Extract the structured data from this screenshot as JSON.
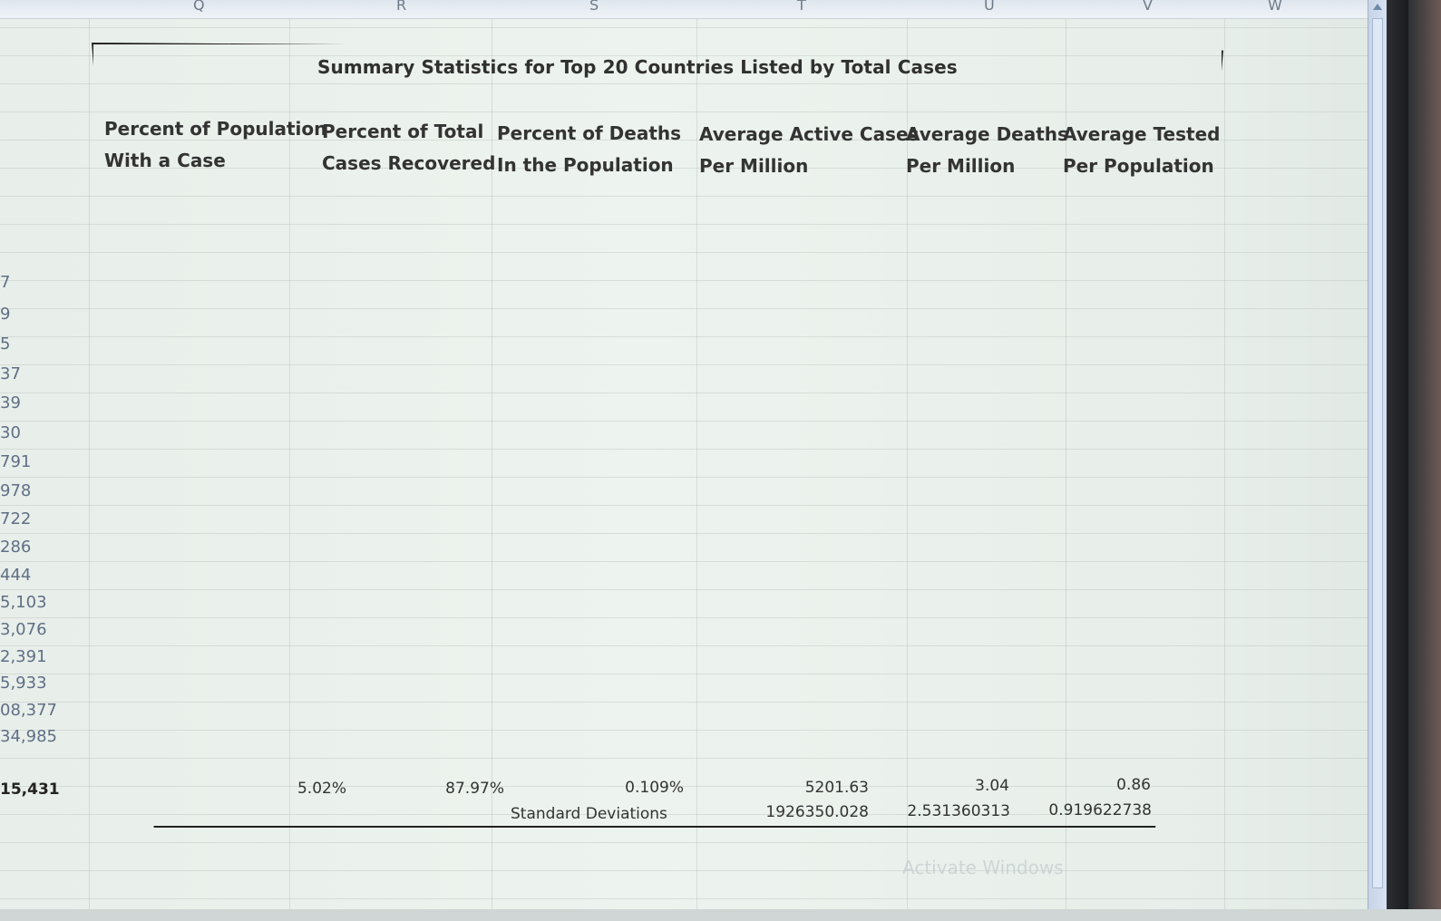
{
  "columns": [
    "Q",
    "R",
    "S",
    "T",
    "U",
    "V",
    "W"
  ],
  "left_column_values": [
    "7",
    "9",
    "5",
    "37",
    "39",
    "30",
    "791",
    "978",
    "722",
    "286",
    "444",
    "5,103",
    "3,076",
    "2,391",
    "5,933",
    "08,377",
    "34,985"
  ],
  "left_total": "15,431",
  "summary": {
    "title": "Summary Statistics for Top 20 Countries Listed by Total Cases",
    "headers": [
      {
        "line1": "Percent of Population",
        "line2": "With a Case"
      },
      {
        "line1": "Percent of Total",
        "line2": "Cases Recovered"
      },
      {
        "line1": "Percent of Deaths",
        "line2": "In the Population"
      },
      {
        "line1": "Average Active Cases",
        "line2": "Per Million"
      },
      {
        "line1": "Average Deaths",
        "line2": "Per Million"
      },
      {
        "line1": "Average Tested",
        "line2": "Per Population"
      }
    ],
    "values": [
      "5.02%",
      "87.97%",
      "0.109%",
      "5201.63",
      "3.04",
      "0.86"
    ],
    "std_label": "Standard Deviations",
    "std_values": [
      "1926350.028",
      "2.531360313",
      "0.919622738"
    ]
  },
  "watermark": "Activate Windows"
}
